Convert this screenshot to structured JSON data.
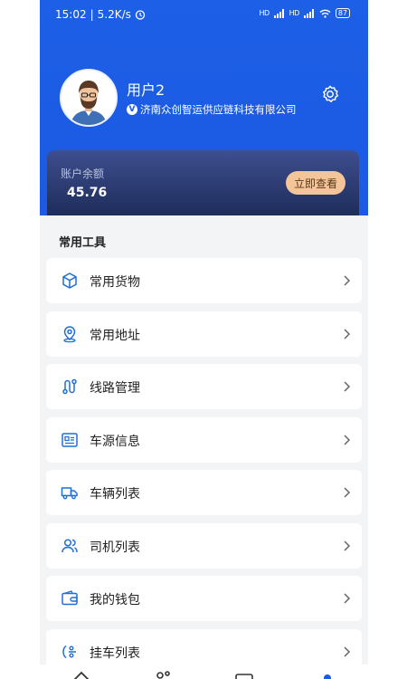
{
  "status_bar": {
    "time": "15:02",
    "speed": "5.2K/s",
    "signal1": "HD",
    "signal2": "HD",
    "battery": "87"
  },
  "profile": {
    "username": "用户2",
    "company": "济南众创智运供应链科技有限公司",
    "badge": "V"
  },
  "balance": {
    "label": "账户余额",
    "value": "45.76",
    "button": "立即查看"
  },
  "tools": {
    "title": "常用工具",
    "items": [
      {
        "label": "常用货物",
        "icon": "box-icon"
      },
      {
        "label": "常用地址",
        "icon": "location-pin-icon"
      },
      {
        "label": "线路管理",
        "icon": "route-icon"
      },
      {
        "label": "车源信息",
        "icon": "id-card-icon"
      },
      {
        "label": "车辆列表",
        "icon": "truck-icon"
      },
      {
        "label": "司机列表",
        "icon": "users-icon"
      },
      {
        "label": "我的钱包",
        "icon": "wallet-icon"
      },
      {
        "label": "挂车列表",
        "icon": "trailer-icon"
      }
    ]
  },
  "colors": {
    "primary": "#1c5ae3",
    "card": "#2a3a6e",
    "accent_button": "#f4c598"
  }
}
